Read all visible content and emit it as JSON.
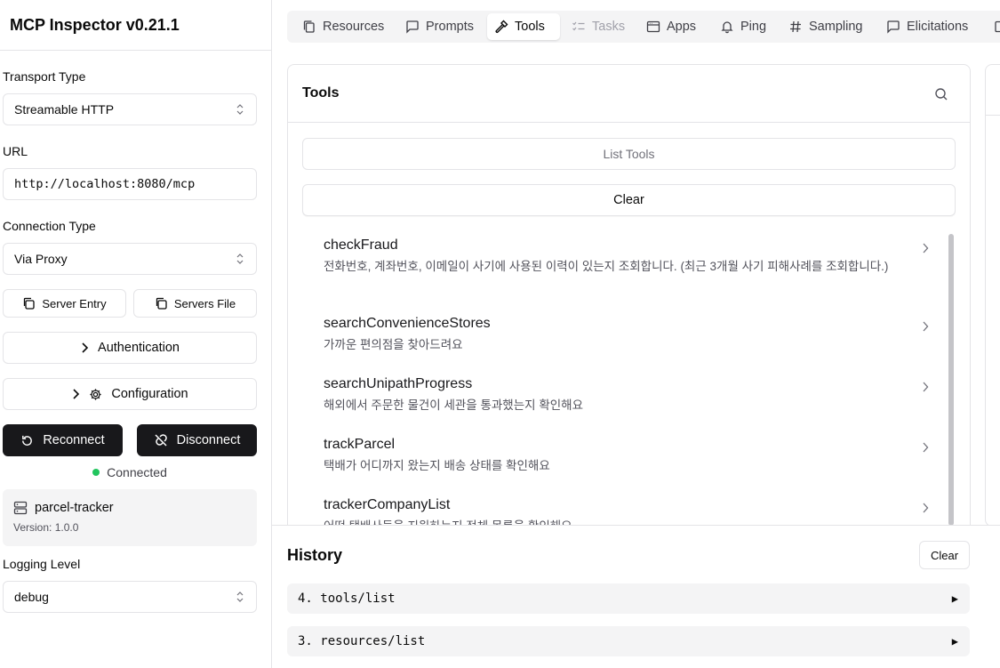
{
  "app": {
    "title": "MCP Inspector v0.21.1"
  },
  "sidebar": {
    "transport_label": "Transport Type",
    "transport_value": "Streamable HTTP",
    "url_label": "URL",
    "url_value": "http://localhost:8080/mcp",
    "connection_label": "Connection Type",
    "connection_value": "Via Proxy",
    "server_entry": "Server Entry",
    "servers_file": "Servers File",
    "authentication": "Authentication",
    "configuration": "Configuration",
    "reconnect": "Reconnect",
    "disconnect": "Disconnect",
    "status": "Connected",
    "status_color": "#22c55e",
    "server_name": "parcel-tracker",
    "server_version": "Version: 1.0.0",
    "logging_label": "Logging Level",
    "logging_value": "debug"
  },
  "tabs": [
    {
      "label": "Resources",
      "icon": "resources-icon"
    },
    {
      "label": "Prompts",
      "icon": "message-square-icon"
    },
    {
      "label": "Tools",
      "icon": "hammer-icon",
      "active": true
    },
    {
      "label": "Tasks",
      "icon": "list-checks-icon",
      "disabled": true
    },
    {
      "label": "Apps",
      "icon": "app-window-icon"
    },
    {
      "label": "Ping",
      "icon": "bell-icon"
    },
    {
      "label": "Sampling",
      "icon": "hash-icon"
    },
    {
      "label": "Elicitations",
      "icon": "message-square-icon"
    }
  ],
  "tools": {
    "title": "Tools",
    "list_button": "List Tools",
    "clear_button": "Clear",
    "items": [
      {
        "name": "checkFraud",
        "description": "전화번호, 계좌번호, 이메일이 사기에 사용된 이력이 있는지 조회합니다. (최근 3개월 사기 피해사례를 조회합니다.)"
      },
      {
        "name": "searchConvenienceStores",
        "description": "가까운 편의점을 찾아드려요"
      },
      {
        "name": "searchUnipathProgress",
        "description": "해외에서 주문한 물건이 세관을 통과했는지 확인해요"
      },
      {
        "name": "trackParcel",
        "description": "택배가 어디까지 왔는지 배송 상태를 확인해요"
      },
      {
        "name": "trackerCompanyList",
        "description": "어떤 택배사들을 지원하는지 전체 목록을 확인해요"
      }
    ]
  },
  "history": {
    "title": "History",
    "clear_button": "Clear",
    "items": [
      {
        "label": "4. tools/list"
      },
      {
        "label": "3. resources/list"
      }
    ]
  }
}
